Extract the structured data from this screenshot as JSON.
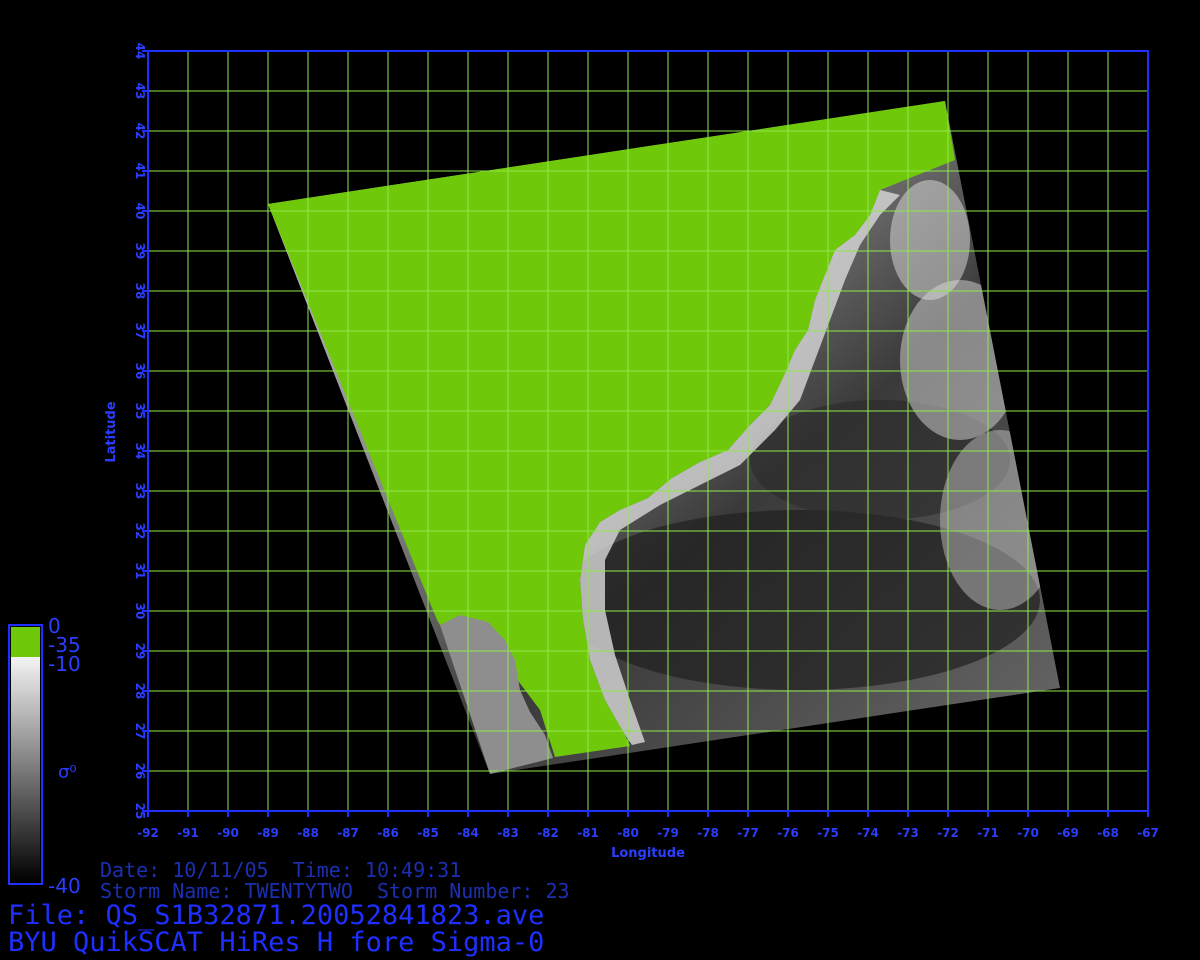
{
  "map": {
    "lon_range": [
      -92,
      -67
    ],
    "lat_range": [
      25,
      44
    ],
    "lon_ticks": [
      "-92",
      "-91",
      "-90",
      "-89",
      "-88",
      "-87",
      "-86",
      "-85",
      "-84",
      "-83",
      "-82",
      "-81",
      "-80",
      "-79",
      "-78",
      "-77",
      "-76",
      "-75",
      "-74",
      "-73",
      "-72",
      "-71",
      "-70",
      "-69",
      "-68",
      "-67"
    ],
    "lat_ticks": [
      "25",
      "26",
      "27",
      "28",
      "29",
      "30",
      "31",
      "32",
      "33",
      "34",
      "35",
      "36",
      "37",
      "38",
      "39",
      "40",
      "41",
      "42",
      "43",
      "44"
    ],
    "xlabel": "Longitude",
    "ylabel": "Latitude",
    "grid": true,
    "colors": {
      "background": "#000000",
      "frame": "#1e2fff",
      "tick_text": "#2b3dff",
      "grid": "#8fe84a",
      "land": "#6fc80a",
      "ocean_light": "#b8b8b8",
      "ocean_dark": "#222222"
    }
  },
  "colorbar": {
    "labels": [
      "0",
      "-35",
      "-10",
      "σ⁰",
      "-40"
    ],
    "land_color": "#6fc80a"
  },
  "meta": {
    "date_line": "Date: 10/11/05  Time: 10:49:31",
    "storm_line": "Storm Name: TWENTYTWO  Storm Number: 23",
    "file_line": "File: QS_S1B32871.20052841823.ave",
    "product_line": "BYU QuikSCAT HiRes H fore Sigma-0"
  }
}
